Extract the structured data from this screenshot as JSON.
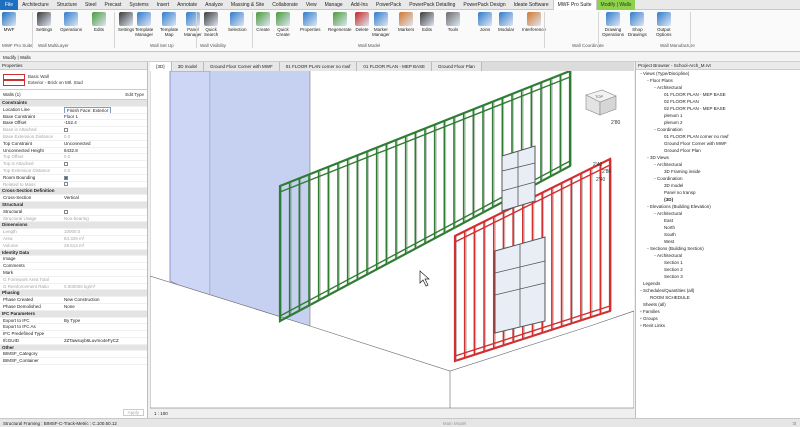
{
  "ribbon": {
    "tabs": [
      "File",
      "Architecture",
      "Structure",
      "Steel",
      "Precast",
      "Systems",
      "Insert",
      "Annotate",
      "Analyze",
      "Massing & Site",
      "Collaborate",
      "View",
      "Manage",
      "Add-Ins",
      "PowerPack",
      "PowerPack Detailing",
      "PowerPack Design",
      "Ideate Software",
      "MWF Pro Suite",
      "Modify | Walls"
    ],
    "active_tab": "MWF Pro Suite",
    "buttons": [
      {
        "label": "MWF",
        "icon": "mwf-logo-icon"
      },
      {
        "label": "Settings",
        "icon": "settings-icon"
      },
      {
        "label": "Operations",
        "icon": "operations-icon"
      },
      {
        "label": "Edits",
        "icon": "edits-icon"
      },
      {
        "label": "Settings",
        "icon": "settings-icon"
      },
      {
        "label": "Template\nManager",
        "icon": "template-manager-icon"
      },
      {
        "label": "Template\nMap",
        "icon": "template-map-icon"
      },
      {
        "label": "Panel\nManager",
        "icon": "panel-manager-icon"
      },
      {
        "label": "Quick\nSearch",
        "icon": "quick-search-icon"
      },
      {
        "label": "Selection",
        "icon": "selection-icon"
      },
      {
        "label": "Create",
        "icon": "create-icon"
      },
      {
        "label": "Quick\nCreate",
        "icon": "quick-create-icon"
      },
      {
        "label": "Properties",
        "icon": "properties-icon"
      },
      {
        "label": "Regenerate",
        "icon": "regenerate-icon"
      },
      {
        "label": "Delete",
        "icon": "delete-icon"
      },
      {
        "label": "Marker\nManager",
        "icon": "marker-manager-icon"
      },
      {
        "label": "Markers",
        "icon": "markers-icon"
      },
      {
        "label": "Edits",
        "icon": "edits-icon"
      },
      {
        "label": "Tools",
        "icon": "tools-icon"
      },
      {
        "label": "Joins",
        "icon": "joins-icon"
      },
      {
        "label": "Modular",
        "icon": "modular-icon"
      },
      {
        "label": "Interference",
        "icon": "interference-icon"
      },
      {
        "label": "Drawing\nOperations",
        "icon": "drawing-operations-icon"
      },
      {
        "label": "Shop\nDrawings",
        "icon": "shop-drawings-icon"
      },
      {
        "label": "Output\nOptions",
        "icon": "output-options-icon"
      }
    ],
    "groups": [
      "MWF Pro Suite",
      "Wall MultiLayer",
      "Wall Set Up",
      "Wall Visibility",
      "Wall Model",
      "Wall Coordinate",
      "Wall Manufacture"
    ]
  },
  "context_label": "Modify | Walls",
  "properties": {
    "title": "Properties",
    "type_family": "Basic Wall",
    "type_name": "Exterior - Brick on Mtl. Stud",
    "instance_filter": "Walls (1)",
    "edit_type": "Edit Type",
    "apply": "Apply",
    "rows": [
      {
        "kind": "section",
        "key": "Constraints"
      },
      {
        "key": "Location Line",
        "value": "Finish Face: Exterior",
        "boxed": true
      },
      {
        "key": "Base Constraint",
        "value": "Floor 1"
      },
      {
        "key": "Base Offset",
        "value": "-152.4"
      },
      {
        "key": "Base is Attached",
        "value": "check",
        "dim": true
      },
      {
        "key": "Base Extension Distance",
        "value": "0.0",
        "dim": true
      },
      {
        "key": "Top Constraint",
        "value": "Unconnected"
      },
      {
        "key": "Unconnected Height",
        "value": "8432.8"
      },
      {
        "key": "Top Offset",
        "value": "0.0",
        "dim": true
      },
      {
        "key": "Top is Attached",
        "value": "check",
        "dim": true
      },
      {
        "key": "Top Extension Distance",
        "value": "0.0",
        "dim": true
      },
      {
        "key": "Room Bounding",
        "value": "checked"
      },
      {
        "key": "Related to Mass",
        "value": "check",
        "dim": true
      },
      {
        "kind": "section",
        "key": "Cross-Section Definition"
      },
      {
        "key": "Cross-Section",
        "value": "Vertical"
      },
      {
        "kind": "section",
        "key": "Structural"
      },
      {
        "key": "Structural",
        "value": "check"
      },
      {
        "key": "Structural Usage",
        "value": "Non-bearing",
        "dim": true
      },
      {
        "kind": "section",
        "key": "Dimensions"
      },
      {
        "key": "Length",
        "value": "10000.0",
        "dim": true
      },
      {
        "key": "Area",
        "value": "84.329 m²",
        "dim": true
      },
      {
        "key": "Volume",
        "value": "29.513 m³",
        "dim": true
      },
      {
        "kind": "section",
        "key": "Identity Data"
      },
      {
        "key": "Image",
        "value": ""
      },
      {
        "key": "Comments",
        "value": ""
      },
      {
        "key": "Mark",
        "value": ""
      },
      {
        "key": "G Formwork Area Total",
        "value": "",
        "dim": true
      },
      {
        "key": "G Reinforcement Ratio",
        "value": "0.000000 kg/m³",
        "dim": true
      },
      {
        "kind": "section",
        "key": "Phasing"
      },
      {
        "key": "Phase Created",
        "value": "New Construction"
      },
      {
        "key": "Phase Demolished",
        "value": "None"
      },
      {
        "kind": "section",
        "key": "IFC Parameters"
      },
      {
        "key": "Export to IFC",
        "value": "By Type"
      },
      {
        "key": "Export to IFC As",
        "value": ""
      },
      {
        "key": "IFC Predefined Type",
        "value": ""
      },
      {
        "key": "IfcGUID",
        "value": "2ZTawsuyb6Luvmo4eFyCZ"
      },
      {
        "kind": "section",
        "key": "Other"
      },
      {
        "key": "BIMSF_Category",
        "value": ""
      },
      {
        "key": "BIMSF_Container",
        "value": ""
      }
    ]
  },
  "view_tabs": [
    "{3D}",
    "3D model",
    "Ground Floor Corner with MWF",
    "01 FLOOR PLAN corner no mwf",
    "01 FLOOR PLAN - MEP BASE",
    "Ground Floor Plan"
  ],
  "active_view": "{3D}",
  "view_bar": {
    "scale": "1 : 100"
  },
  "viewcube": {
    "label": "TOP"
  },
  "model_labels": [
    "2'80",
    "2'40",
    "2'80",
    "2'40"
  ],
  "browser": {
    "title": "Project Browser - School-Arch_M.rvt",
    "nodes": [
      {
        "d": 0,
        "t": "−",
        "label": "Views (Type/Discipline)"
      },
      {
        "d": 1,
        "t": "−",
        "label": "Floor Plans"
      },
      {
        "d": 2,
        "t": "−",
        "label": "Architectural"
      },
      {
        "d": 3,
        "t": "",
        "label": "01 FLOOR PLAN - MEP BASE"
      },
      {
        "d": 3,
        "t": "",
        "label": "02 FLOOR PLAN"
      },
      {
        "d": 3,
        "t": "",
        "label": "02 FLOOR PLAN - MEP BASE"
      },
      {
        "d": 3,
        "t": "",
        "label": "plenum 1"
      },
      {
        "d": 3,
        "t": "",
        "label": "plenum 2"
      },
      {
        "d": 2,
        "t": "−",
        "label": "Coordination"
      },
      {
        "d": 3,
        "t": "",
        "label": "01 FLOOR PLAN corner no mwf"
      },
      {
        "d": 3,
        "t": "",
        "label": "Ground Floor Corner with MWF"
      },
      {
        "d": 3,
        "t": "",
        "label": "Ground Floor Plan"
      },
      {
        "d": 1,
        "t": "−",
        "label": "3D Views"
      },
      {
        "d": 2,
        "t": "−",
        "label": "Architectural"
      },
      {
        "d": 3,
        "t": "",
        "label": "3D Framing inside"
      },
      {
        "d": 2,
        "t": "−",
        "label": "Coordination"
      },
      {
        "d": 3,
        "t": "",
        "label": "3D model"
      },
      {
        "d": 3,
        "t": "",
        "label": "Panel no transp"
      },
      {
        "d": 3,
        "t": "",
        "label": "{3D}",
        "bold": true
      },
      {
        "d": 1,
        "t": "−",
        "label": "Elevations (Building Elevation)"
      },
      {
        "d": 2,
        "t": "−",
        "label": "Architectural"
      },
      {
        "d": 3,
        "t": "",
        "label": "East"
      },
      {
        "d": 3,
        "t": "",
        "label": "North"
      },
      {
        "d": 3,
        "t": "",
        "label": "South"
      },
      {
        "d": 3,
        "t": "",
        "label": "West"
      },
      {
        "d": 1,
        "t": "−",
        "label": "Sections (Building Section)"
      },
      {
        "d": 2,
        "t": "−",
        "label": "Architectural"
      },
      {
        "d": 3,
        "t": "",
        "label": "Section 1"
      },
      {
        "d": 3,
        "t": "",
        "label": "Section 2"
      },
      {
        "d": 3,
        "t": "",
        "label": "Section 3"
      },
      {
        "d": 0,
        "t": "",
        "label": "Legends"
      },
      {
        "d": 0,
        "t": "−",
        "label": "Schedules/Quantities (all)"
      },
      {
        "d": 1,
        "t": "",
        "label": "ROOM SCHEDULE"
      },
      {
        "d": 0,
        "t": "",
        "label": "Sheets (all)"
      },
      {
        "d": 0,
        "t": "+",
        "label": "Families"
      },
      {
        "d": 0,
        "t": "+",
        "label": "Groups"
      },
      {
        "d": 0,
        "t": "+",
        "label": "Revit Links"
      }
    ]
  },
  "status": {
    "text": "Structural Framing : BIMSF-C-Track-Metric : C.100.50.12",
    "model": "Main Model",
    "right": ":0"
  },
  "colors": {
    "accent": "#1e6fc0",
    "context_tab": "#8fd14f",
    "stud_green": "#2e7d32",
    "stud_red": "#d32f2f",
    "glass_blue": "#aab9e8"
  }
}
